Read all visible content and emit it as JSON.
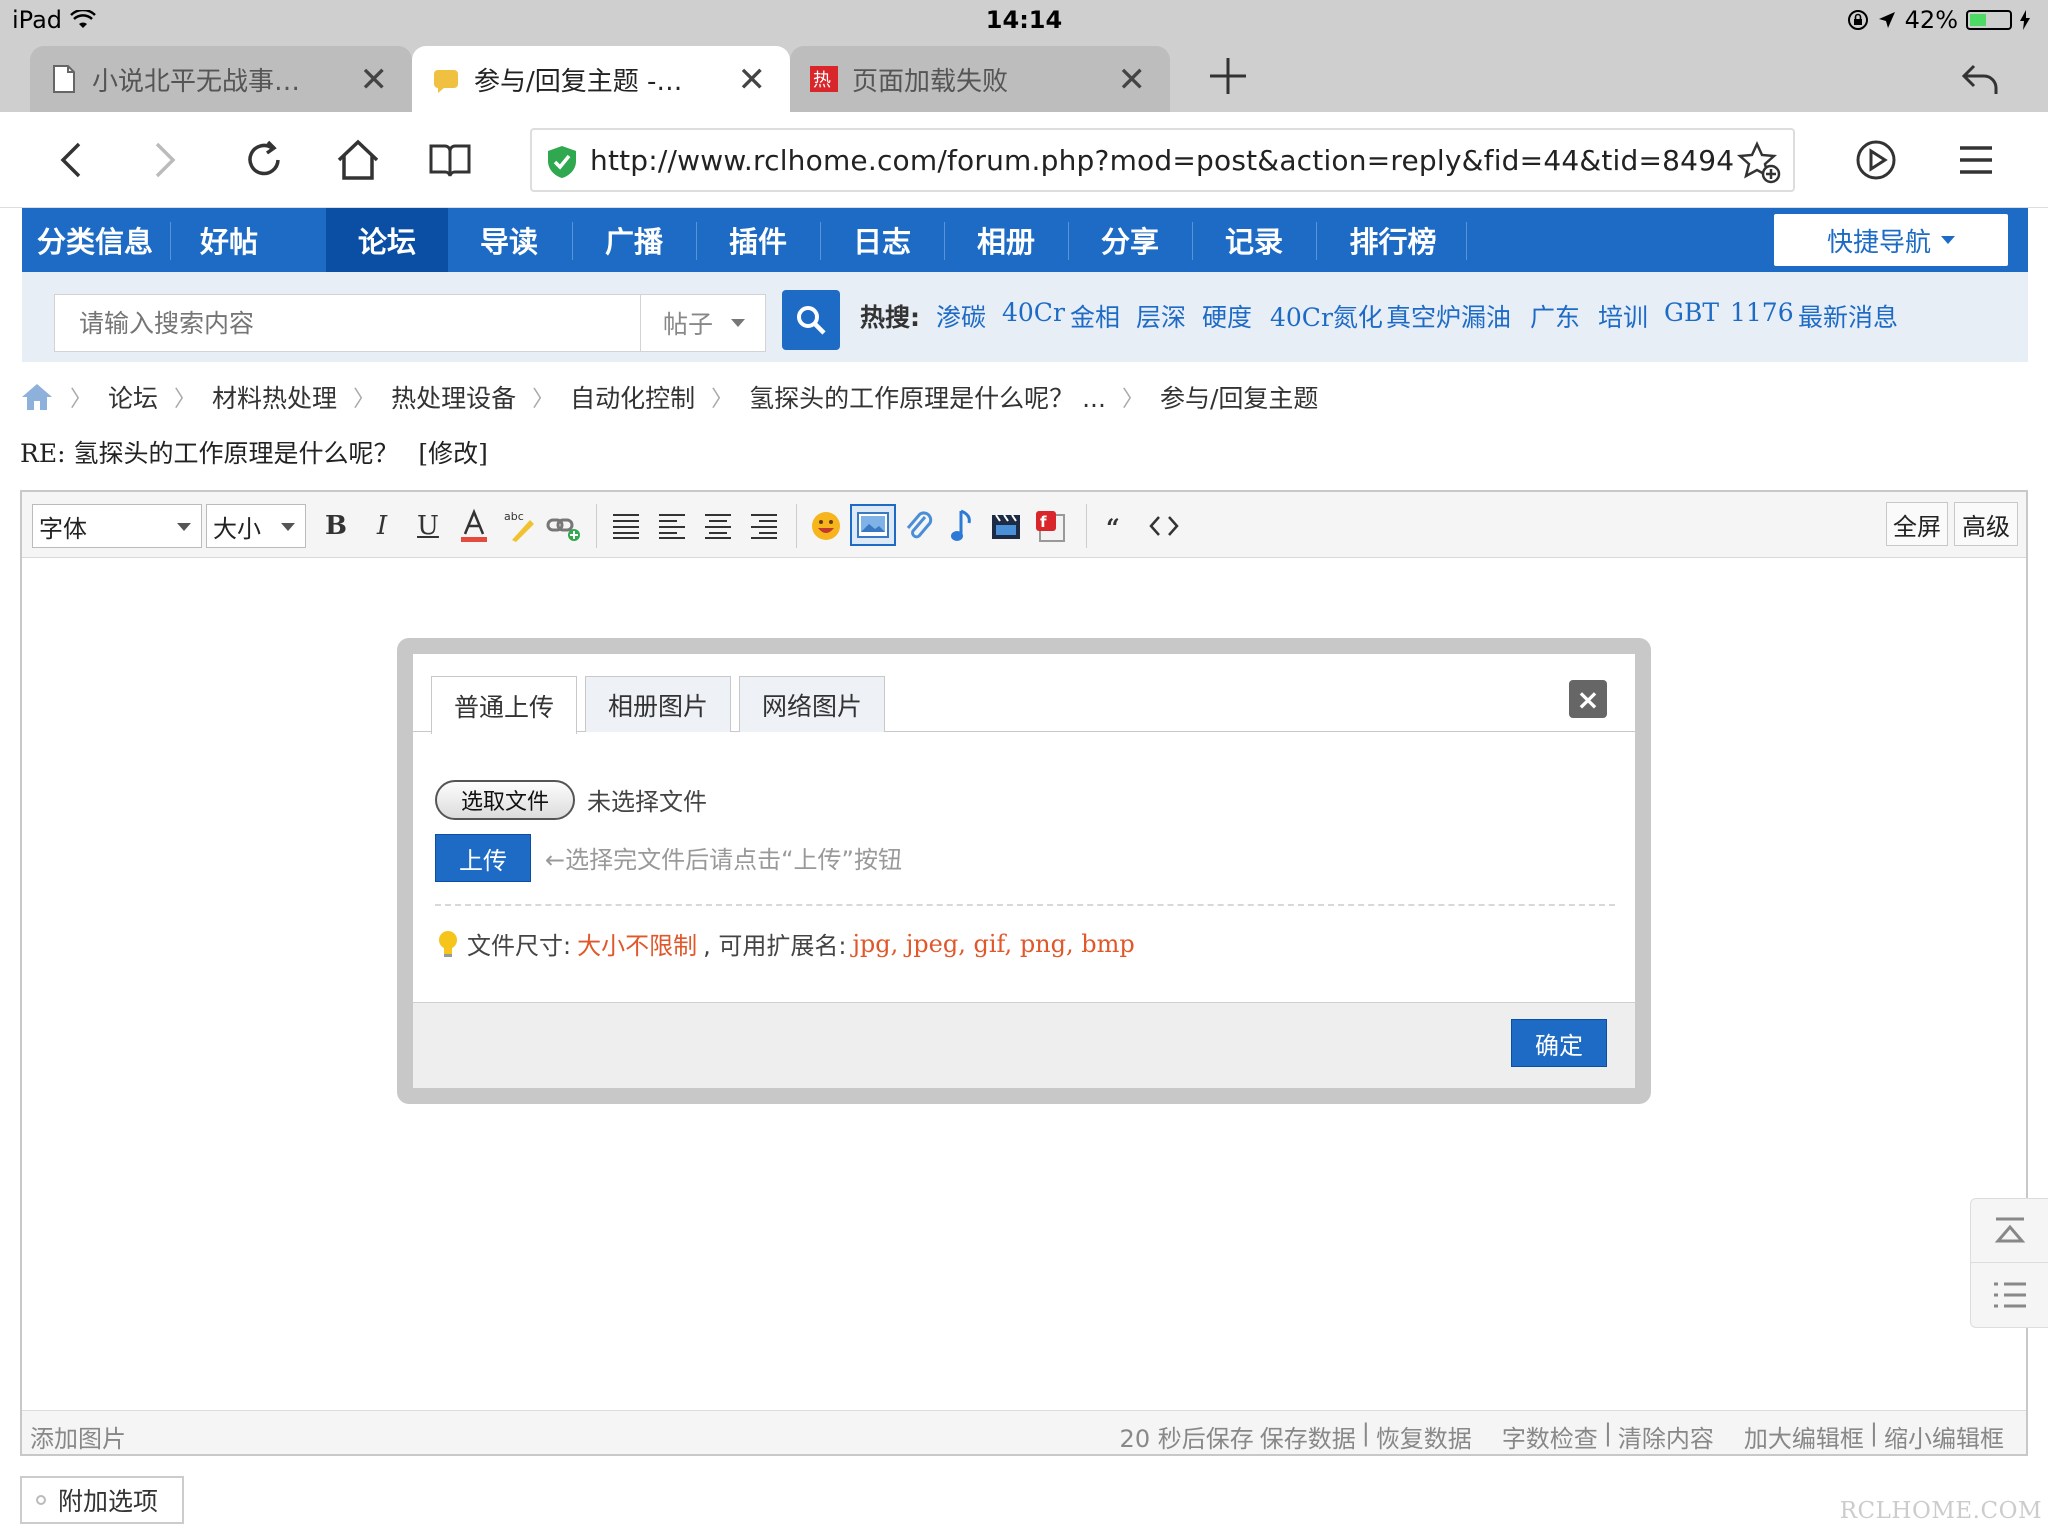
{
  "status": {
    "device": "iPad",
    "time": "14:14",
    "battery": "42%",
    "battery_level": 0.42
  },
  "tabs": [
    {
      "title": "小说北平无战事…",
      "active": false
    },
    {
      "title": "参与/回复主题 -…",
      "active": true
    },
    {
      "title": "页面加载失败",
      "active": false
    }
  ],
  "toolbar": {
    "url": "http://www.rclhome.com/forum.php?mod=post&action=reply&fid=44&tid=8494"
  },
  "forumnav": {
    "items": [
      "分类信息",
      "好帖",
      "论坛",
      "导读",
      "广播",
      "插件",
      "日志",
      "相册",
      "分享",
      "记录",
      "排行榜"
    ],
    "active_index": 2,
    "quicknav": "快捷导航"
  },
  "search": {
    "placeholder": "请输入搜索内容",
    "type": "帖子",
    "hot_label": "热搜:",
    "hot_terms": [
      "渗碳",
      "40Cr",
      "金相",
      "层深",
      "硬度",
      "40Cr氮化",
      "真空炉漏油",
      "广东",
      "培训",
      "GBT",
      "1176",
      "最新消息"
    ]
  },
  "breadcrumb": [
    "论坛",
    "材料热处理",
    "热处理设备",
    "自动化控制",
    "氢探头的工作原理是什么呢？ ...",
    "参与/回复主题"
  ],
  "post": {
    "title": "RE: 氢探头的工作原理是什么呢？",
    "edit_link": "[修改]"
  },
  "editor": {
    "font_label": "字体",
    "size_label": "大小",
    "bold": "B",
    "italic": "I",
    "underline": "U",
    "fullscreen": "全屏",
    "advanced": "高级",
    "footer_left": "添加图片",
    "footer_right": {
      "autosave": "20 秒后保存",
      "save": "保存数据",
      "restore": "恢复数据",
      "count": "字数检查",
      "clear": "清除内容",
      "enlarge": "加大编辑框",
      "shrink": "缩小编辑框",
      "sep": "|"
    }
  },
  "modal": {
    "tabs": [
      "普通上传",
      "相册图片",
      "网络图片"
    ],
    "active_tab": 0,
    "close": "×",
    "choose_file": "选取文件",
    "no_file": "未选择文件",
    "upload": "上传",
    "upload_hint": "←选择完文件后请点击“上传”按钮",
    "size_label": "文件尺寸:",
    "size_value": "大小不限制",
    "ext_label": ", 可用扩展名:",
    "ext_value": "jpg, jpeg, gif, png, bmp",
    "ok": "确定"
  },
  "add_options": "附加选项",
  "watermark": "RCLHOME.COM",
  "colors": {
    "brand_blue": "#1e6bc6",
    "nav_active": "#0a4fa3",
    "accent_red": "#e0572a"
  }
}
